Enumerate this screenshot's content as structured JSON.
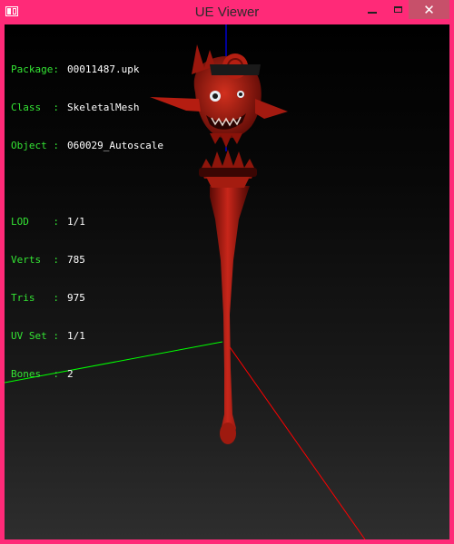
{
  "window": {
    "title": "UE Viewer",
    "icon": "app-window-icon",
    "controls": {
      "minimize_icon": "minimize-icon",
      "maximize_icon": "maximize-icon",
      "close_glyph": "✕"
    },
    "frame_color": "#ff2a78",
    "close_button_color": "#c7506a"
  },
  "info": {
    "package": {
      "label": "Package:",
      "value": "00011487.upk"
    },
    "class": {
      "label": "Class  :",
      "value": "SkeletalMesh"
    },
    "object": {
      "label": "Object :",
      "value": "060029_Autoscale"
    },
    "lod": {
      "label": "LOD    :",
      "value": "1/1"
    },
    "verts": {
      "label": "Verts  :",
      "value": "785"
    },
    "tris": {
      "label": "Tris   :",
      "value": "975"
    },
    "uvset": {
      "label": "UV Set :",
      "value": "1/1"
    },
    "bones": {
      "label": "Bones  :",
      "value": "2"
    },
    "label_color": "#34e534",
    "value_color": "#ffffff"
  },
  "scene": {
    "mesh": "demon-head-staff",
    "mesh_color": "#b01a10",
    "axes": {
      "x_color": "#ff0000",
      "y_color": "#00ff00",
      "z_color": "#0000ff"
    }
  }
}
